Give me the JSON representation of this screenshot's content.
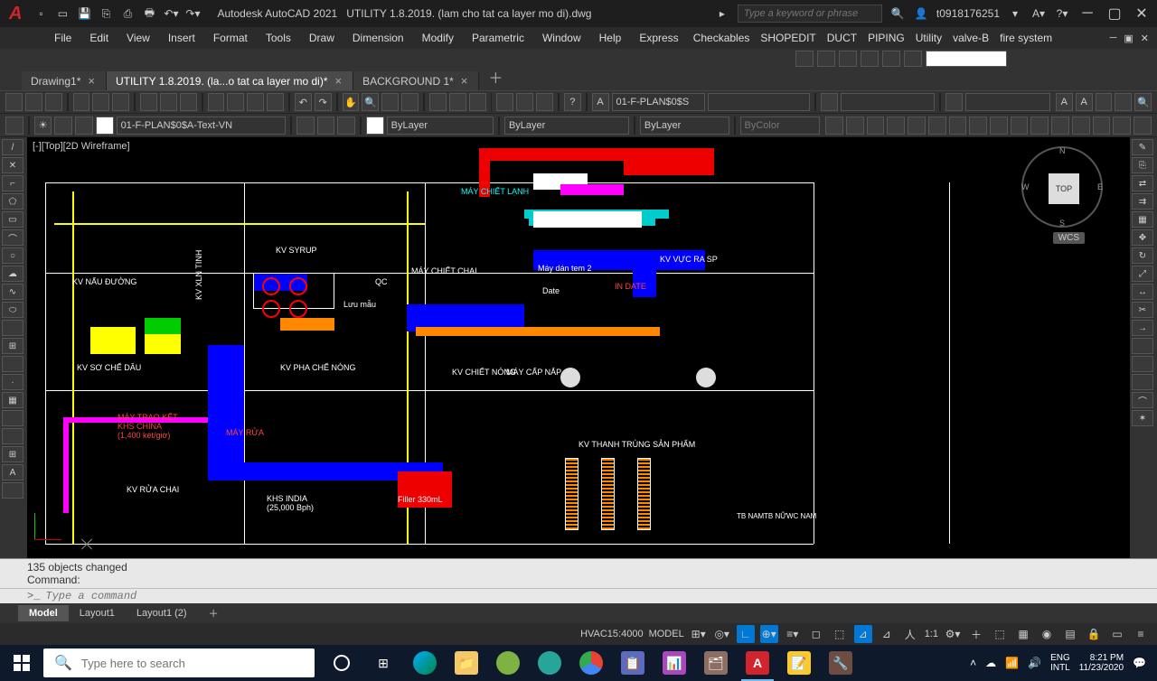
{
  "app": {
    "title_prefix": "Autodesk AutoCAD 2021",
    "filename": "UTILITY 1.8.2019. (lam cho tat ca layer mo di).dwg",
    "search_placeholder": "Type a keyword or phrase",
    "user": "t0918176251"
  },
  "menu": [
    "File",
    "Edit",
    "View",
    "Insert",
    "Format",
    "Tools",
    "Draw",
    "Dimension",
    "Modify",
    "Parametric",
    "Window",
    "Help",
    "Express",
    "Checkables",
    "SHOPEDIT",
    "DUCT",
    "PIPING",
    "Utility",
    "valve-B",
    "fire system"
  ],
  "tabs": [
    {
      "label": "Drawing1*",
      "active": false
    },
    {
      "label": "UTILITY 1.8.2019. (la...o tat ca layer mo di)*",
      "active": true
    },
    {
      "label": "BACKGROUND 1*",
      "active": false
    }
  ],
  "layer_combo": "01-F-PLAN$0$S",
  "layer_combo2": "01-F-PLAN$0$A-Text-VN",
  "props": {
    "color": "ByLayer",
    "linetype": "ByLayer",
    "lineweight": "ByLayer",
    "plotstyle": "ByColor"
  },
  "viewport": {
    "label": "[-][Top][2D Wireframe]",
    "cube": {
      "top": "TOP",
      "n": "N",
      "s": "S",
      "e": "E",
      "w": "W"
    },
    "wcs": "WCS"
  },
  "drawing_text": {
    "kv_nau_duong": "KV NẤU ĐƯỜNG",
    "kv_so_che": "KV SƠ CHẾ DÂU",
    "kv_rua_chai": "KV RỬA CHAI",
    "kv_syrup": "KV SYRUP",
    "kv_pha_che": "KV PHA CHẾ NÓNG",
    "may_chiet": "MÁY CHIẾT CHAI",
    "may_chiet_lanh": "MÁY CHIẾT LẠNH",
    "kv_chiet_nong": "KV CHIẾT NÓNG",
    "kv_thanh_trung": "KV THANH TRÙNG SẢN PHẨM",
    "kv_vuc_ra": "KV VỰC RA SP",
    "in_date": "IN DATE",
    "date": "Date",
    "may_dan_tem": "Máy dán tem 2",
    "filler": "Filler 330mL",
    "luu_mau": "Lưu mẫu",
    "qc": "QC",
    "may_cap": "MÁY CẤP NẮP",
    "tb_nam": "TB NAM",
    "tb_nu": "TB NỮ",
    "wc_nam": "WC NAM",
    "kv_xln": "KV XLN TINH",
    "khs": "KHS INDIA",
    "khs2": "(25,000 Bph)",
    "may_trao_ket": "MÁY TRAO KẾT",
    "khs_china": "KHS CHINA",
    "khs_china2": "(1,400 két/giờ)",
    "may_rua": "MÁY RỬA"
  },
  "command": {
    "history1": "135 objects changed",
    "history2": "Command:",
    "prompt": ">_",
    "placeholder": "Type a command"
  },
  "model_tabs": [
    "Model",
    "Layout1",
    "Layout1 (2)"
  ],
  "status": {
    "scale": "HVAC15:4000",
    "space": "MODEL",
    "anno": "1:1"
  },
  "windows": {
    "search_placeholder": "Type here to search",
    "lang": "ENG",
    "kb": "INTL",
    "time": "8:21 PM",
    "date": "11/23/2020"
  }
}
